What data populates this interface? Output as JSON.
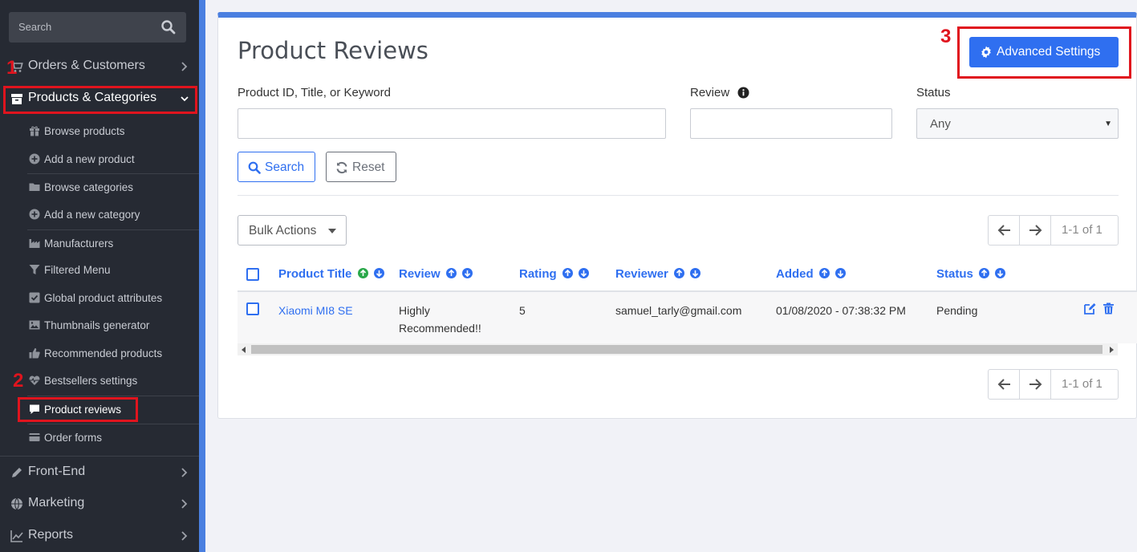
{
  "sidebar": {
    "search_placeholder": "Search",
    "top_items": [
      {
        "label": "Orders & Customers",
        "icon": "cart-icon"
      },
      {
        "label": "Products & Categories",
        "icon": "archive-icon"
      },
      {
        "label": "Front-End",
        "icon": "pencil-icon"
      },
      {
        "label": "Marketing",
        "icon": "globe-icon"
      },
      {
        "label": "Reports",
        "icon": "line-chart-icon"
      }
    ],
    "sub_items": [
      {
        "label": "Browse products",
        "icon": "gift-icon"
      },
      {
        "label": "Add a new product",
        "icon": "plus-circle-icon"
      },
      {
        "label": "Browse categories",
        "icon": "folder-icon"
      },
      {
        "label": "Add a new category",
        "icon": "plus-circle-icon"
      },
      {
        "label": "Manufacturers",
        "icon": "industry-icon"
      },
      {
        "label": "Filtered Menu",
        "icon": "filter-icon"
      },
      {
        "label": "Global product attributes",
        "icon": "check-square-icon"
      },
      {
        "label": "Thumbnails generator",
        "icon": "image-icon"
      },
      {
        "label": "Recommended products",
        "icon": "thumbs-up-icon"
      },
      {
        "label": "Bestsellers settings",
        "icon": "heartbeat-icon"
      },
      {
        "label": "Product reviews",
        "icon": "comment-icon"
      },
      {
        "label": "Order forms",
        "icon": "credit-card-icon"
      }
    ]
  },
  "annotations": {
    "m1": "1",
    "m2": "2",
    "m3": "3"
  },
  "page": {
    "title": "Product Reviews",
    "advanced_settings_label": "Advanced Settings"
  },
  "filters": {
    "keyword_label": "Product ID, Title, or Keyword",
    "keyword_value": "",
    "review_label": "Review",
    "review_value": "",
    "status_label": "Status",
    "status_value": "Any",
    "search_label": "Search",
    "reset_label": "Reset"
  },
  "toolbar": {
    "bulk_actions_label": "Bulk Actions",
    "pagination_text": "1-1 of 1"
  },
  "table": {
    "columns": [
      "Product Title",
      "Review",
      "Rating",
      "Reviewer",
      "Added",
      "Status"
    ],
    "rows": [
      {
        "product_title": "Xiaomi MI8 SE",
        "review_line1": "Highly",
        "review_line2": "Recommended!!",
        "rating": "5",
        "reviewer": "samuel_tarly@gmail.com",
        "added": "01/08/2020 - 07:38:32 PM",
        "status": "Pending"
      }
    ]
  },
  "colors": {
    "accent": "#2f6ff0",
    "sidebar_bg": "#262a33",
    "highlight_red": "#e0141e",
    "sort_up_active": "#2aa84a"
  }
}
